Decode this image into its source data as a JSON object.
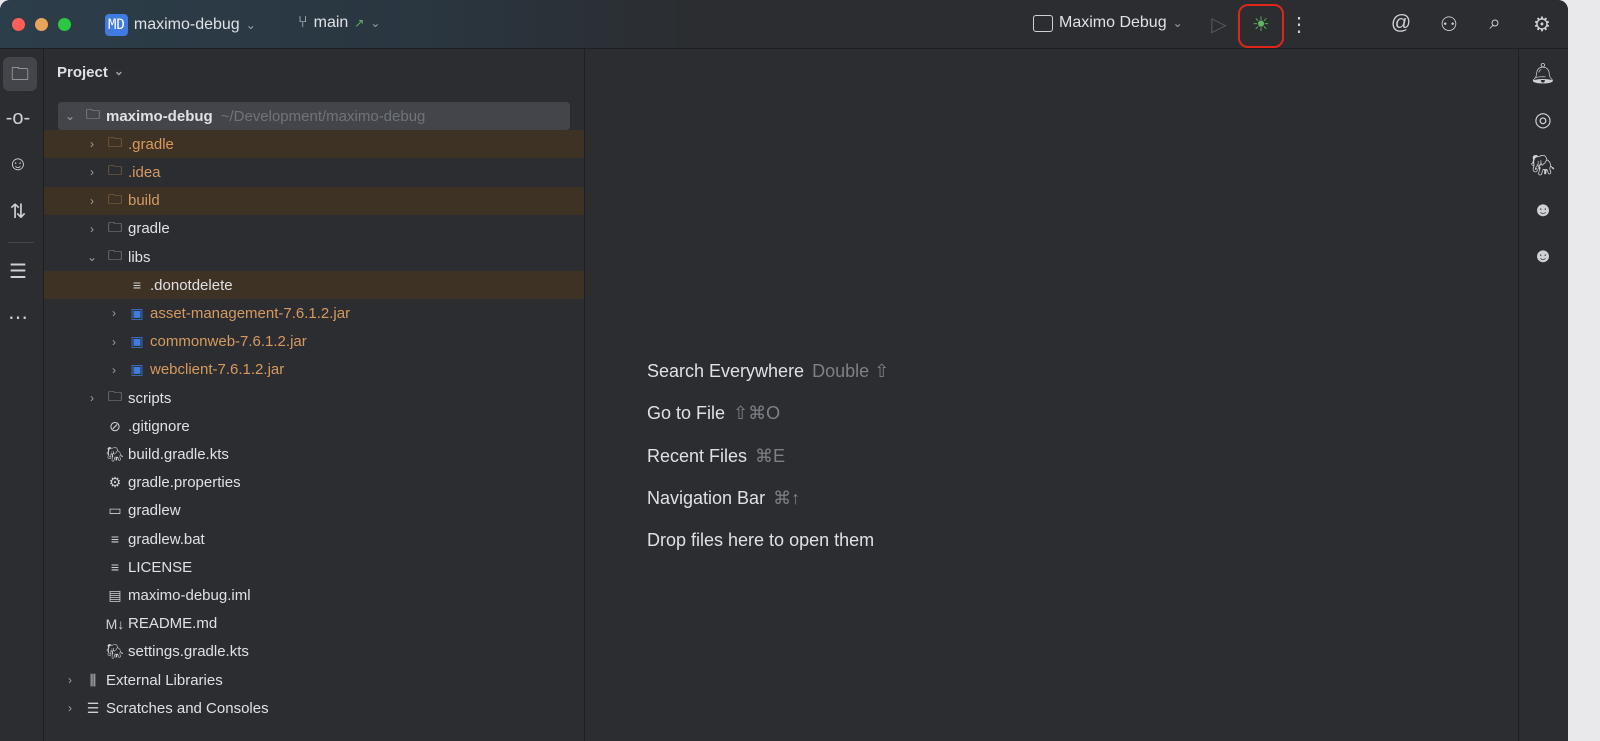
{
  "titlebar": {
    "project_badge": "MD",
    "project_name": "maximo-debug",
    "branch": "main",
    "branch_arrow": "↗",
    "run_config": "Maximo Debug"
  },
  "panel": {
    "title": "Project"
  },
  "tree": [
    {
      "label": "maximo-debug",
      "path": "~/Development/maximo-debug",
      "level": 0,
      "arrow": "⌄",
      "icon": "module-folder-icon",
      "style": "sel"
    },
    {
      "label": ".gradle",
      "level": 1,
      "arrow": "›",
      "icon": "folder-icon",
      "style": "hl",
      "color": "orange"
    },
    {
      "label": ".idea",
      "level": 1,
      "arrow": "›",
      "icon": "folder-icon",
      "color": "orange"
    },
    {
      "label": "build",
      "level": 1,
      "arrow": "›",
      "icon": "folder-icon",
      "style": "hl",
      "color": "orange"
    },
    {
      "label": "gradle",
      "level": 1,
      "arrow": "›",
      "icon": "folder-icon"
    },
    {
      "label": "libs",
      "level": 1,
      "arrow": "⌄",
      "icon": "folder-icon"
    },
    {
      "label": ".donotdelete",
      "level": 2,
      "arrow": "",
      "icon": "text-file-icon",
      "style": "hl"
    },
    {
      "label": "asset-management-7.6.1.2.jar",
      "level": 2,
      "arrow": "›",
      "icon": "jar-icon",
      "color": "orange"
    },
    {
      "label": "commonweb-7.6.1.2.jar",
      "level": 2,
      "arrow": "›",
      "icon": "jar-icon",
      "color": "orange"
    },
    {
      "label": "webclient-7.6.1.2.jar",
      "level": 2,
      "arrow": "›",
      "icon": "jar-icon",
      "color": "orange"
    },
    {
      "label": "scripts",
      "level": 1,
      "arrow": "›",
      "icon": "folder-icon"
    },
    {
      "label": ".gitignore",
      "level": 1,
      "arrow": "",
      "icon": "ignore-file-icon"
    },
    {
      "label": "build.gradle.kts",
      "level": 1,
      "arrow": "",
      "icon": "gradle-file-icon"
    },
    {
      "label": "gradle.properties",
      "level": 1,
      "arrow": "",
      "icon": "gear-file-icon"
    },
    {
      "label": "gradlew",
      "level": 1,
      "arrow": "",
      "icon": "shell-file-icon"
    },
    {
      "label": "gradlew.bat",
      "level": 1,
      "arrow": "",
      "icon": "text-file-icon"
    },
    {
      "label": "LICENSE",
      "level": 1,
      "arrow": "",
      "icon": "text-file-icon"
    },
    {
      "label": "maximo-debug.iml",
      "level": 1,
      "arrow": "",
      "icon": "iml-file-icon"
    },
    {
      "label": "README.md",
      "level": 1,
      "arrow": "",
      "icon": "markdown-file-icon"
    },
    {
      "label": "settings.gradle.kts",
      "level": 1,
      "arrow": "",
      "icon": "gradle-file-icon"
    },
    {
      "label": "External Libraries",
      "level": 0,
      "arrow": "›",
      "icon": "library-icon"
    },
    {
      "label": "Scratches and Consoles",
      "level": 0,
      "arrow": "›",
      "icon": "scratches-icon"
    }
  ],
  "editor_hints": [
    {
      "label": "Search Everywhere",
      "shortcut": "Double ⇧"
    },
    {
      "label": "Go to File",
      "shortcut": "⇧⌘O"
    },
    {
      "label": "Recent Files",
      "shortcut": "⌘E"
    },
    {
      "label": "Navigation Bar",
      "shortcut": "⌘↑"
    },
    {
      "label": "Drop files here to open them",
      "shortcut": ""
    }
  ],
  "colors": {
    "debug": "#5fb85c",
    "highlight_ring": "#e0261a",
    "orange_text": "#d69a5f"
  }
}
